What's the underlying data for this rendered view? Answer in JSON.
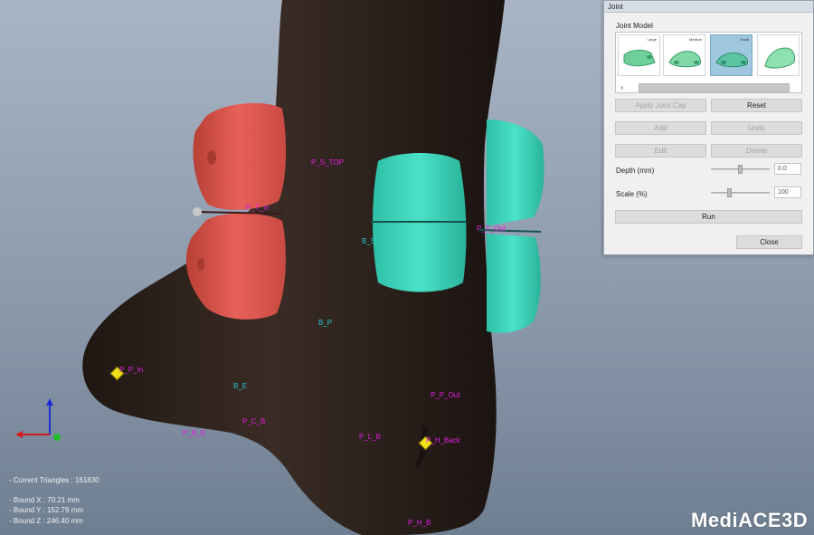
{
  "dialog": {
    "title": "Joint",
    "section_label": "Joint Model",
    "thumbnails": [
      {
        "label": "Large",
        "selected": false
      },
      {
        "label": "Medium",
        "selected": false
      },
      {
        "label": "Small",
        "selected": true
      },
      {
        "label": "",
        "selected": false
      }
    ],
    "scroll_left": "‹",
    "buttons": {
      "apply_joint_cap": "Apply Joint Cap",
      "reset": "Reset",
      "add": "Add",
      "undo": "Undo",
      "edit": "Edit",
      "delete": "Delete",
      "run": "Run",
      "close": "Close"
    },
    "depth": {
      "label": "Depth (mm)",
      "value": "0.0",
      "slider_level": 0.5
    },
    "scale": {
      "label": "Scale (%)",
      "value": "100",
      "slider_level": 0.3
    }
  },
  "scene": {
    "points_magenta": [
      "P_S_TOP",
      "P_T_In",
      "P_T_Out",
      "P_P_In",
      "P_P_Out",
      "P_C_B",
      "P_B_B",
      "P_L_B",
      "P_H_Back",
      "P_H_B"
    ],
    "points_cyan": [
      "B_S",
      "B_P",
      "B_E"
    ]
  },
  "stats": {
    "triangles": "- Current Triangles : 161830",
    "bound_x": "- Bound X : 70.21 mm",
    "bound_y": "- Bound Y : 152.79 mm",
    "bound_z": "- Bound Z : 246.40 mm"
  },
  "logo": "MediACE3D",
  "colors": {
    "background_top": "#a9b5c4",
    "foot": "#2f231d",
    "red_joint": "#e2584f",
    "teal_joint": "#3fd7bd",
    "marker": "#f1e21a",
    "label_magenta": "#e41ee4",
    "label_cyan": "#27c9cf"
  }
}
